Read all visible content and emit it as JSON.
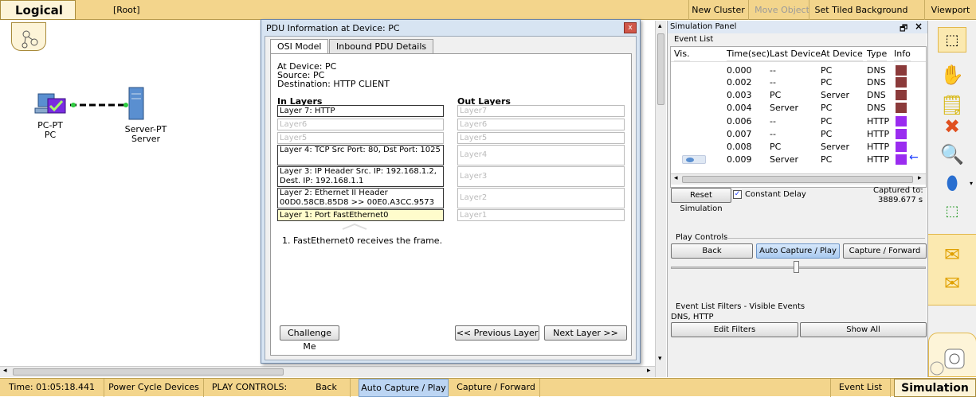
{
  "topbar": {
    "logical_tab": "Logical",
    "root": "[Root]",
    "new_cluster": "New Cluster",
    "move_object": "Move Object",
    "set_tiled_background": "Set Tiled Background",
    "viewport": "Viewport"
  },
  "devices": {
    "pc": {
      "type": "PC-PT",
      "name": "PC"
    },
    "server": {
      "type": "Server-PT",
      "name": "Server"
    }
  },
  "pdu_window": {
    "title": "PDU Information at Device: PC",
    "close": "x",
    "tabs": [
      "OSI Model",
      "Inbound PDU Details"
    ],
    "at_device": "At Device: PC",
    "source": "Source: PC",
    "destination": "Destination: HTTP CLIENT",
    "in_layers_header": "In Layers",
    "out_layers_header": "Out Layers",
    "in_layers": [
      "Layer 7: HTTP",
      "Layer6",
      "Layer5",
      "Layer 4: TCP Src Port: 80, Dst Port: 1025",
      "Layer 3: IP Header Src. IP: 192.168.1.2, Dest. IP: 192.168.1.1",
      "Layer 2: Ethernet II Header 00D0.58CB.85D8 >> 00E0.A3CC.9573",
      "Layer 1: Port FastEthernet0"
    ],
    "out_layers": [
      "Layer7",
      "Layer6",
      "Layer5",
      "Layer4",
      "Layer3",
      "Layer2",
      "Layer1"
    ],
    "description": "1. FastEthernet0 receives the frame.",
    "challenge_me": "Challenge Me",
    "previous_layer": "<< Previous Layer",
    "next_layer": "Next Layer >>"
  },
  "sim_panel": {
    "title": "Simulation Panel",
    "event_list_label": "Event List",
    "columns": [
      "Vis.",
      "Time(sec)",
      "Last Device",
      "At Device",
      "Type",
      "Info"
    ],
    "events": [
      {
        "time": "0.000",
        "last": "--",
        "at": "PC",
        "type": "DNS",
        "color": "#8b3a3a"
      },
      {
        "time": "0.002",
        "last": "--",
        "at": "PC",
        "type": "DNS",
        "color": "#8b3a3a"
      },
      {
        "time": "0.003",
        "last": "PC",
        "at": "Server",
        "type": "DNS",
        "color": "#8b3a3a"
      },
      {
        "time": "0.004",
        "last": "Server",
        "at": "PC",
        "type": "DNS",
        "color": "#8b3a3a"
      },
      {
        "time": "0.006",
        "last": "--",
        "at": "PC",
        "type": "HTTP",
        "color": "#9a2cf0"
      },
      {
        "time": "0.007",
        "last": "--",
        "at": "PC",
        "type": "HTTP",
        "color": "#9a2cf0"
      },
      {
        "time": "0.008",
        "last": "PC",
        "at": "Server",
        "type": "HTTP",
        "color": "#9a2cf0"
      },
      {
        "time": "0.009",
        "last": "Server",
        "at": "PC",
        "type": "HTTP",
        "color": "#9a2cf0"
      }
    ],
    "reset_simulation": "Reset Simulation",
    "constant_delay": "Constant Delay",
    "captured_to_label": "Captured to:",
    "captured_to_value": "3889.677 s",
    "play_controls": "Play Controls",
    "back": "Back",
    "auto_capture_play": "Auto Capture / Play",
    "capture_forward": "Capture / Forward",
    "filters_label": "Event List Filters - Visible Events",
    "filters_value": "DNS, HTTP",
    "edit_filters": "Edit Filters",
    "show_all": "Show All"
  },
  "statusbar": {
    "time": "Time: 01:05:18.441",
    "power_cycle": "Power Cycle Devices",
    "play_controls": "PLAY CONTROLS:",
    "back": "Back",
    "auto_capture_play": "Auto Capture / Play",
    "capture_forward": "Capture / Forward",
    "event_list": "Event List",
    "simulation": "Simulation"
  },
  "colors": {
    "accent": "#f3d58c",
    "http": "#9a2cf0",
    "dns": "#8b3a3a",
    "selection": "#bcd5f3"
  }
}
